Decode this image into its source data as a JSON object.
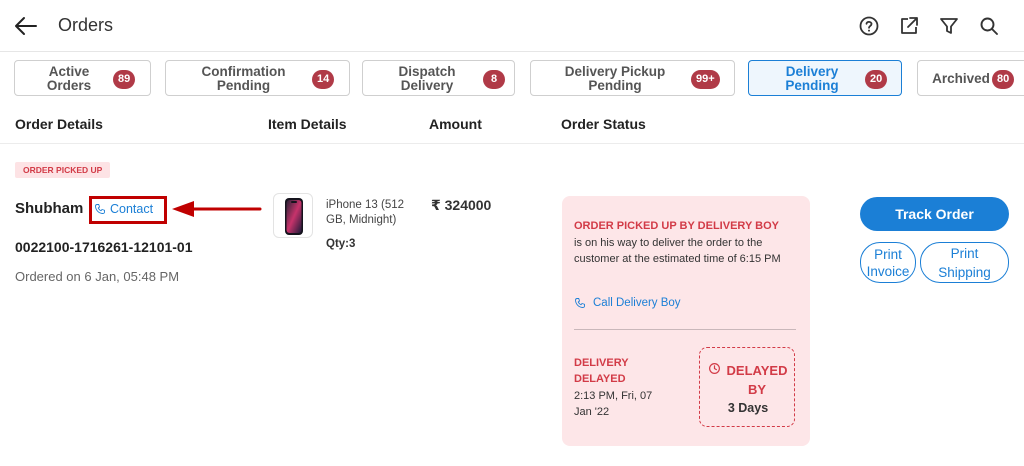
{
  "header": {
    "title": "Orders",
    "icons": [
      "back-arrow-icon",
      "help-icon",
      "export-icon",
      "filter-icon",
      "search-icon"
    ]
  },
  "tabs": [
    {
      "label": "Active Orders",
      "count": "89",
      "active": false
    },
    {
      "label": "Confirmation Pending",
      "count": "14",
      "active": false
    },
    {
      "label": "Dispatch Delivery",
      "count": "8",
      "active": false
    },
    {
      "label": "Delivery Pickup Pending",
      "count": "99+",
      "active": false
    },
    {
      "label": "Delivery Pending",
      "count": "20",
      "active": true
    },
    {
      "label": "Archived",
      "count": "80",
      "active": false
    }
  ],
  "columns": {
    "order_details": "Order Details",
    "item_details": "Item Details",
    "amount": "Amount",
    "order_status": "Order Status"
  },
  "order": {
    "status_tag": "ORDER PICKED UP",
    "customer_name": "Shubham",
    "contact_label": "Contact",
    "order_id": "0022100-1716261-12101-01",
    "ordered_on": "Ordered on 6 Jan, 05:48 PM",
    "item": {
      "name": "iPhone 13 (512 GB, Midnight)",
      "qty": "Qty:3"
    },
    "amount": "₹ 324000",
    "status_card": {
      "title": "ORDER PICKED UP BY DELIVERY BOY",
      "message": "is on his way to deliver the order to the customer at the estimated time of 6:15 PM",
      "call_label": "Call Delivery Boy",
      "delay_title": "DELIVERY DELAYED",
      "delay_time": "2:13 PM, Fri, 07 Jan '22",
      "delayed_by_label": "DELAYED BY",
      "delayed_by_value": "3 Days"
    },
    "actions": {
      "track": "Track Order",
      "print_invoice": "Print Invoice",
      "print_shipping": "Print Shipping Label"
    }
  },
  "colors": {
    "accent": "#1b7fd6",
    "badge": "#b03a47",
    "alert": "#d23b47",
    "card_bg": "#fde6e8",
    "highlight": "#c00000"
  }
}
